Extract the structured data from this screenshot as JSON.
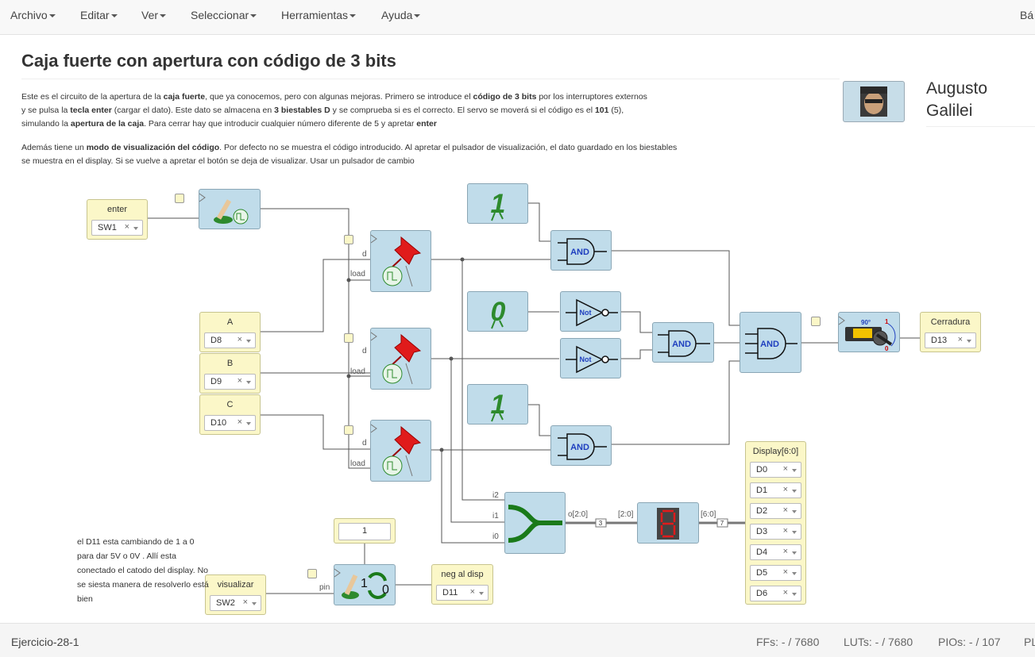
{
  "menu": [
    "Archivo",
    "Editar",
    "Ver",
    "Seleccionar",
    "Herramientas",
    "Ayuda"
  ],
  "menu_right": "Bá",
  "title": "Caja fuerte con apertura con código de 3 bits",
  "description": {
    "p1_line1": [
      "Este es el circuito de la apertura de la ",
      "caja fuerte",
      ", que ya conocemos, pero con algunas mejoras. Primero se introduce el ",
      "código de 3 bits",
      " por los interruptores externos"
    ],
    "p1_line2": [
      "y se pulsa la ",
      "tecla enter",
      " (cargar el dato). Este dato se almacena en ",
      "3 biestables D",
      " y se comprueba si es el correcto. El servo se moverá si el código es el ",
      "101",
      " (5),"
    ],
    "p1_line3": [
      "simulando la ",
      "apertura de la caja",
      ". Para cerrar hay que introducir cualquier número diferente de 5 y apretar ",
      "enter"
    ],
    "p2_line1": [
      "Además tiene un ",
      "modo de visualización del código",
      ". Por defecto no se muestra el código introducido. Al apretar el pulsador de visualización, el dato guardado en los biestables"
    ],
    "p2_line2": "se muestra en el display. Si se vuelve a apretar el botón se deja de visualizar. Usar un pulsador de cambio"
  },
  "author": {
    "first": "Augusto",
    "last": "Galilei"
  },
  "inputs": {
    "enter": {
      "label": "enter",
      "pin": "SW1"
    },
    "A": {
      "label": "A",
      "pin": "D8"
    },
    "B": {
      "label": "B",
      "pin": "D9"
    },
    "C": {
      "label": "C",
      "pin": "D10"
    },
    "visualizar": {
      "label": "visualizar",
      "pin": "SW2"
    }
  },
  "outputs": {
    "cerradura": {
      "label": "Cerradura",
      "pin": "D13"
    },
    "neg": {
      "label": "neg al disp",
      "pin": "D11"
    },
    "display": {
      "label": "Display[6:0]",
      "pins": [
        "D0",
        "D1",
        "D2",
        "D3",
        "D4",
        "D5",
        "D6"
      ]
    }
  },
  "ports": {
    "d": "d",
    "load": "load",
    "pin": "pin",
    "i2": "i2",
    "i1": "i1",
    "i0": "i0",
    "o": "o[2:0]",
    "in_bus": "[2:0]",
    "out_bus": "[6:0]",
    "bus3": "3",
    "bus7": "7"
  },
  "gates": {
    "and": "AND",
    "not": "Not"
  },
  "constants": {
    "one": "1",
    "zero": "0",
    "const_block": "1"
  },
  "servo": {
    "angle": "90°",
    "one": "1",
    "zero": "0"
  },
  "toggle": {
    "one": "1",
    "zero": "0"
  },
  "clear_x": "×",
  "note": "el D11 esta cambiando de 1 a 0 para dar 5V o 0V . Allí esta conectado el catodo del display. No se siesta manera de resolverlo está bien",
  "status": {
    "project": "Ejercicio-28-1",
    "ffs": "FFs:  - / 7680",
    "luts": "LUTs:  - / 7680",
    "pios": "PIOs:  - / 107",
    "extra": "PL"
  },
  "colors": {
    "block": "#c0dcea",
    "io": "#fbf7c8",
    "wire": "#555555",
    "red_pin": "#e01b1b",
    "green_symbol": "#1a7a1a",
    "gate_text": "#1f3fbf"
  }
}
